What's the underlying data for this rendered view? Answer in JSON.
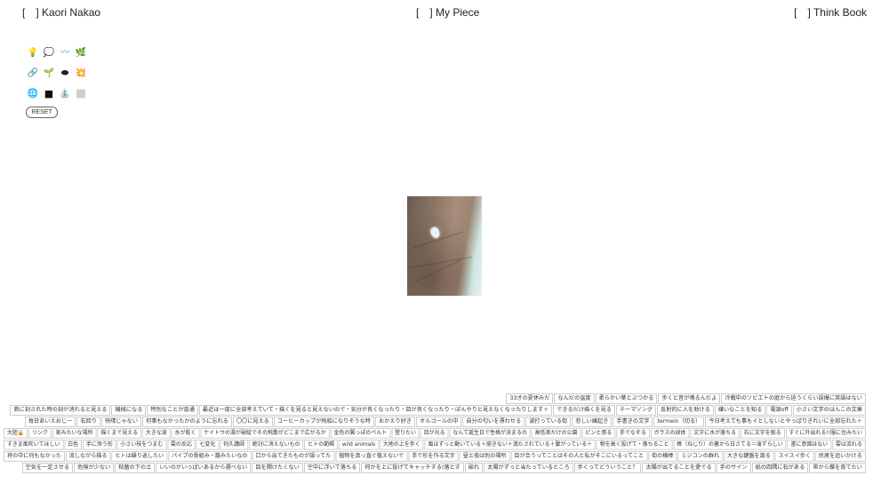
{
  "nav": {
    "left": "[　] Kaori Nakao",
    "center": "[　] My Piece",
    "right": "[　] Think Book"
  },
  "tools": [
    [
      {
        "icon": "light-bulb-icon",
        "glyph": "💡"
      },
      {
        "icon": "thought-bubble-icon",
        "glyph": "💭"
      },
      {
        "icon": "wave-icon",
        "glyph": "〰"
      },
      {
        "icon": "leaf-icon",
        "glyph": "🌿"
      }
    ],
    [
      {
        "icon": "link-icon",
        "glyph": "🔗"
      },
      {
        "icon": "sprout-icon",
        "glyph": "🌱"
      },
      {
        "icon": "black-disc-icon",
        "glyph": "⬬"
      },
      {
        "icon": "sparkle-burst-icon",
        "glyph": "💥"
      }
    ],
    [
      {
        "icon": "globe-icon",
        "glyph": "🌐"
      },
      {
        "icon": "black-square-icon",
        "glyph": "■"
      },
      {
        "icon": "fountain-icon",
        "glyph": "⛲"
      },
      {
        "icon": "gray-square-icon",
        "glyph": "■"
      }
    ]
  ],
  "reset_label": "RESET",
  "tag_rows": [
    [
      "33才の夏休みだ",
      "なんだの温度",
      "柔らかい葉とぶつかる",
      "歩くと音が鳴るんだよ",
      "冷戦中のソビエトの庭から迫うくらい誤爆に英語はない"
    ],
    [
      "鉄に刻された時の刻が消れると見える",
      "機械になる",
      "特別なことが普通",
      "最近は一度に全部考えていて・描くを見ると見えないので・気分が良くなったり・目が良くなったり・ぼんやりと見えなくなったりします＋",
      "できるだけ描くを見る",
      "テーマソング",
      "反射的に人を助ける",
      "嫌いなことを知る",
      "電源off",
      "小さい文字のはんこの文章"
    ],
    [
      "毎日あいえおじー",
      "右回り",
      "快晴じゃない",
      "何事もなかったかのように忘れる",
      "〇〇に見える",
      "コーヒーカップが飛船になりそうな時",
      "おかえり好き",
      "オルゴールの中",
      "自分の匂いを漂わせる",
      "波打っている街",
      "悲しい嫌起き",
      "手書きの文字",
      "termein（切る）",
      "今日考えても事もイとしないとやっぱりきれいに全部忘れた＋"
    ],
    [
      "大胆🔒",
      "リンク",
      "家みたいな場所",
      "描くまで見える",
      "大きな波",
      "水が乾く",
      "ケイトウの湯が破綻でその飛散がどこまで広がるか",
      "金色の翼っぽのペルト",
      "登りたい",
      "目が光る",
      "なんて誕生日で性格が決まるの",
      "高低差だけの公園",
      "ピンと張る",
      "手でなぞる",
      "ガラスの球体",
      "文字に水が落ちる",
      "石に文字を彫る",
      "すぐに外出れる!!服に住みたい"
    ],
    [
      "すきま風吹いてほしい",
      "白色",
      "手に添う形",
      "小さい枝をつまむ",
      "雲の反応",
      "七変化",
      "何久講師",
      "絶対に消えないもの",
      "ヒトの範疇",
      "wild animals",
      "大地の上を歩く",
      "風はずっと動いている＋崩きない＋満たされている＋繋がっている＋",
      "物を高く投げて・落ちること",
      "棒（ねじり）の裏から日さてる＝滝ずらしい",
      "書に意図はない",
      "雲は流れる"
    ],
    [
      "将の中に何もなかった",
      "流しながら描る",
      "ヒトは繰り返したい",
      "パイプの骨組み・籠みたいなの",
      "口から出てきたものが語ってた",
      "植物を真っ直ぐ植えないで",
      "手で形を作る文字",
      "昼と夜は別の場所",
      "目が合うってことはその人と私がそこにいるってこと",
      "街の横棒",
      "ミジコンの群れ",
      "大きな鍵盤を渡る",
      "スイスイ歩く",
      "民尾を追いかける"
    ],
    [
      "空気を一定させる",
      "危険が少ない",
      "粘菌の下の土",
      "いいのがいっぱいあるから選べない",
      "目を開けたくない",
      "空中に浮いて落ちる",
      "何かを上に投げてキャッチする(落とす",
      "破れ",
      "太陽がずっと当たっているところ",
      "歩くってどういうこと？",
      "太陽が出てることを愛でる",
      "手のサイン",
      "紙の四隅に石がある",
      "帯から蝶を育てたい"
    ]
  ]
}
